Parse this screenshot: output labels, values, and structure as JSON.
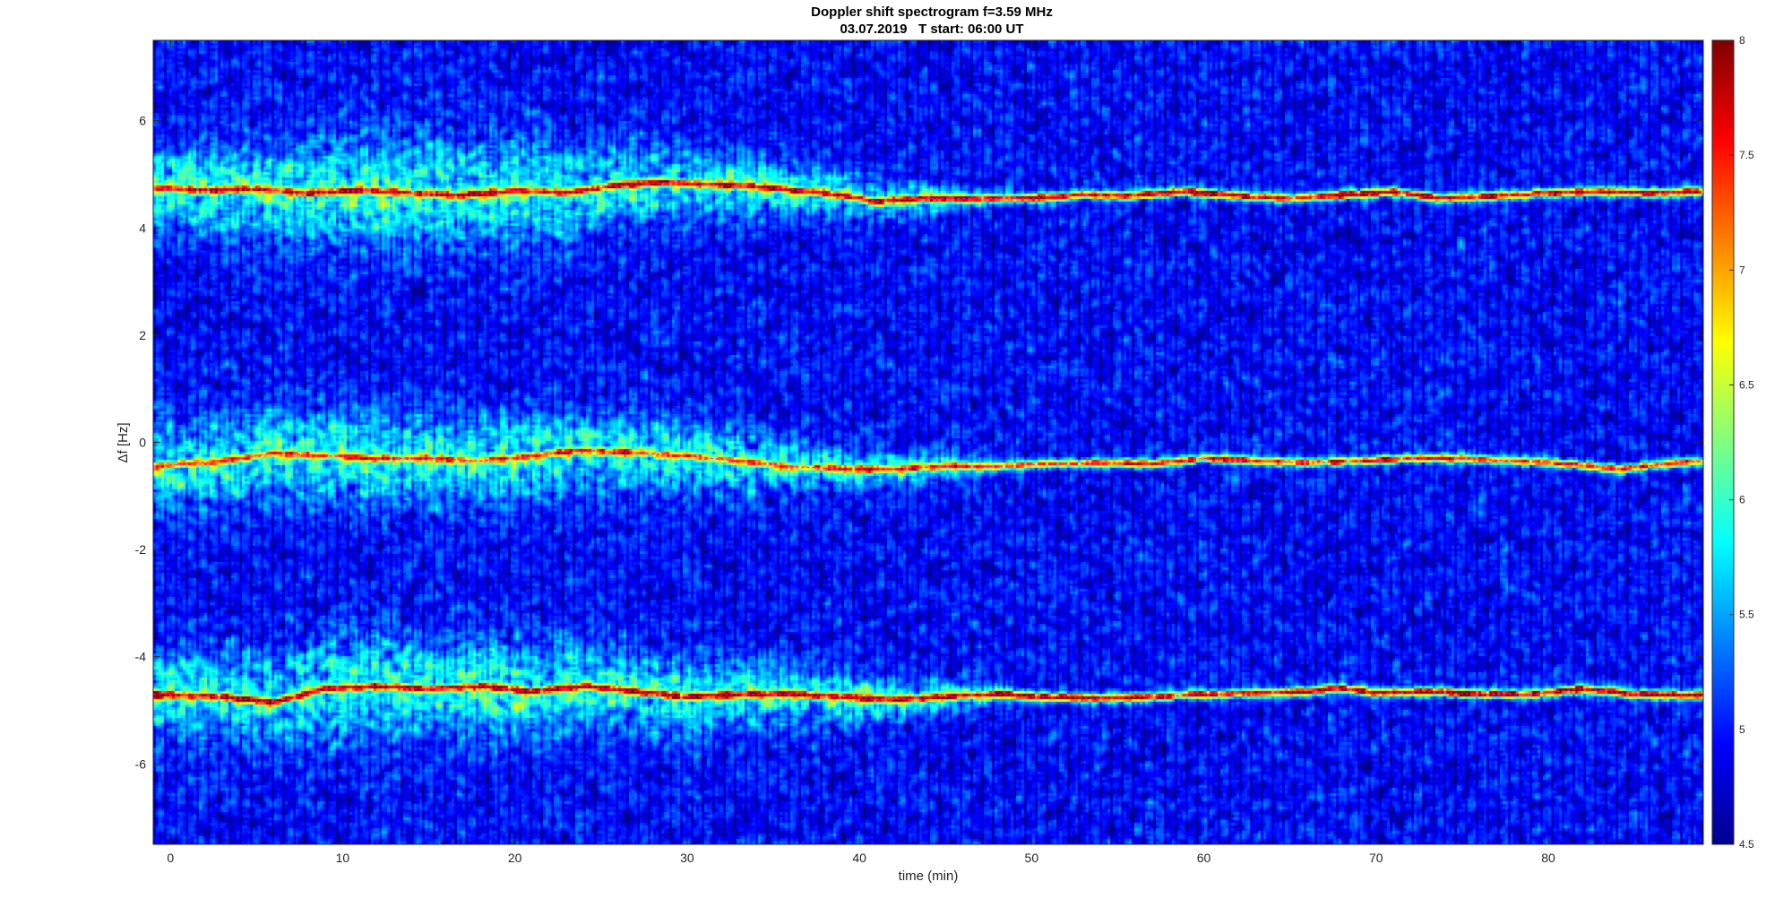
{
  "chart_data": {
    "type": "heatmap",
    "title": "Doppler shift spectrogram f=3.59 MHz",
    "subtitle": "03.07.2019   T start: 06:00 UT",
    "xlabel": "time (min)",
    "ylabel": "Δf [Hz]",
    "xlim": [
      -1,
      89
    ],
    "ylim": [
      -7.5,
      7.5
    ],
    "xticks": [
      0,
      10,
      20,
      30,
      40,
      50,
      60,
      70,
      80
    ],
    "yticks": [
      -6,
      -4,
      -2,
      0,
      2,
      4,
      6
    ],
    "colormap": "jet",
    "clim": [
      4.5,
      8
    ],
    "colorbar_ticks": [
      "4.5",
      "5",
      "5.5",
      "6",
      "6.5",
      "7",
      "7.5",
      "8"
    ],
    "background_level": 5.0,
    "traces": [
      {
        "points": [
          [
            -1,
            4.75
          ],
          [
            2,
            4.7
          ],
          [
            5,
            4.72
          ],
          [
            8,
            4.65
          ],
          [
            11,
            4.7
          ],
          [
            14,
            4.65
          ],
          [
            17,
            4.6
          ],
          [
            20,
            4.7
          ],
          [
            23,
            4.65
          ],
          [
            26,
            4.8
          ],
          [
            29,
            4.85
          ],
          [
            32,
            4.8
          ],
          [
            35,
            4.75
          ],
          [
            38,
            4.65
          ],
          [
            41,
            4.5
          ],
          [
            44,
            4.55
          ],
          [
            47,
            4.55
          ],
          [
            50,
            4.55
          ],
          [
            53,
            4.62
          ],
          [
            56,
            4.6
          ],
          [
            59,
            4.68
          ],
          [
            62,
            4.6
          ],
          [
            65,
            4.55
          ],
          [
            68,
            4.62
          ],
          [
            71,
            4.68
          ],
          [
            74,
            4.55
          ],
          [
            77,
            4.6
          ],
          [
            80,
            4.65
          ],
          [
            83,
            4.68
          ],
          [
            86,
            4.65
          ],
          [
            89,
            4.68
          ]
        ],
        "spread": [
          [
            -1,
            0.5
          ],
          [
            10,
            0.7
          ],
          [
            20,
            0.65
          ],
          [
            30,
            0.45
          ],
          [
            40,
            0.25
          ],
          [
            50,
            0.08
          ],
          [
            89,
            0.08
          ]
        ],
        "peak": 7.8
      },
      {
        "points": [
          [
            -1,
            -0.45
          ],
          [
            3,
            -0.35
          ],
          [
            6,
            -0.2
          ],
          [
            9,
            -0.25
          ],
          [
            12,
            -0.3
          ],
          [
            15,
            -0.3
          ],
          [
            18,
            -0.35
          ],
          [
            21,
            -0.25
          ],
          [
            24,
            -0.15
          ],
          [
            27,
            -0.2
          ],
          [
            30,
            -0.25
          ],
          [
            33,
            -0.35
          ],
          [
            36,
            -0.45
          ],
          [
            39,
            -0.5
          ],
          [
            42,
            -0.5
          ],
          [
            45,
            -0.45
          ],
          [
            48,
            -0.45
          ],
          [
            51,
            -0.4
          ],
          [
            54,
            -0.38
          ],
          [
            57,
            -0.4
          ],
          [
            60,
            -0.3
          ],
          [
            63,
            -0.35
          ],
          [
            66,
            -0.38
          ],
          [
            69,
            -0.35
          ],
          [
            72,
            -0.3
          ],
          [
            75,
            -0.3
          ],
          [
            78,
            -0.35
          ],
          [
            81,
            -0.4
          ],
          [
            84,
            -0.5
          ],
          [
            87,
            -0.4
          ],
          [
            89,
            -0.35
          ]
        ],
        "spread": [
          [
            -1,
            0.55
          ],
          [
            10,
            0.6
          ],
          [
            20,
            0.55
          ],
          [
            30,
            0.45
          ],
          [
            40,
            0.25
          ],
          [
            50,
            0.07
          ],
          [
            89,
            0.07
          ]
        ],
        "peak": 7.3
      },
      {
        "points": [
          [
            -1,
            -4.7
          ],
          [
            3,
            -4.75
          ],
          [
            6,
            -4.85
          ],
          [
            9,
            -4.6
          ],
          [
            12,
            -4.55
          ],
          [
            15,
            -4.6
          ],
          [
            18,
            -4.55
          ],
          [
            21,
            -4.65
          ],
          [
            24,
            -4.55
          ],
          [
            27,
            -4.65
          ],
          [
            30,
            -4.75
          ],
          [
            33,
            -4.7
          ],
          [
            36,
            -4.7
          ],
          [
            39,
            -4.75
          ],
          [
            42,
            -4.8
          ],
          [
            45,
            -4.75
          ],
          [
            48,
            -4.7
          ],
          [
            51,
            -4.75
          ],
          [
            54,
            -4.78
          ],
          [
            57,
            -4.75
          ],
          [
            60,
            -4.7
          ],
          [
            63,
            -4.68
          ],
          [
            66,
            -4.65
          ],
          [
            68,
            -4.58
          ],
          [
            70,
            -4.68
          ],
          [
            73,
            -4.65
          ],
          [
            76,
            -4.7
          ],
          [
            79,
            -4.7
          ],
          [
            82,
            -4.6
          ],
          [
            85,
            -4.7
          ],
          [
            89,
            -4.72
          ]
        ],
        "spread": [
          [
            -1,
            0.5
          ],
          [
            10,
            0.65
          ],
          [
            20,
            0.6
          ],
          [
            30,
            0.5
          ],
          [
            40,
            0.3
          ],
          [
            50,
            0.08
          ],
          [
            89,
            0.08
          ]
        ],
        "peak": 7.9
      }
    ]
  }
}
